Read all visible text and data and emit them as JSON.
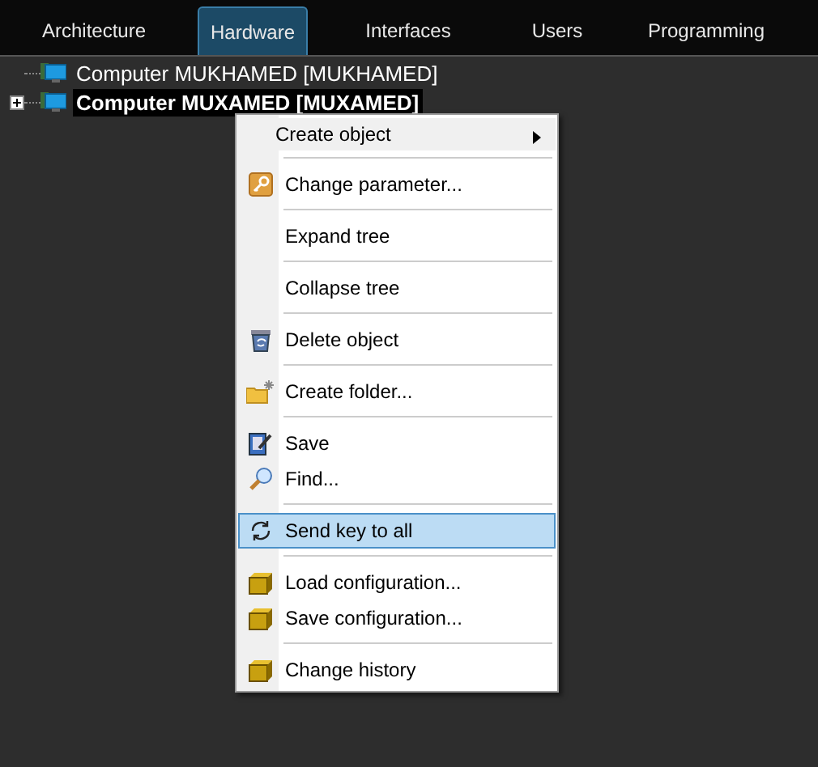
{
  "tabs": [
    {
      "label": "Architecture",
      "selected": false
    },
    {
      "label": "Hardware",
      "selected": true
    },
    {
      "label": "Interfaces",
      "selected": false
    },
    {
      "label": "Users",
      "selected": false
    },
    {
      "label": "Programming",
      "selected": false
    }
  ],
  "tree": [
    {
      "label": "Computer MUKHAMED [MUKHAMED]",
      "selected": false,
      "expandable": false
    },
    {
      "label": "Computer MUXAMED [MUXAMED]",
      "selected": true,
      "expandable": true
    }
  ],
  "context_menu": [
    {
      "kind": "submenu",
      "label": "Create object",
      "selected": false
    },
    {
      "kind": "separator"
    },
    {
      "kind": "key",
      "label": "Change parameter...",
      "selected": false
    },
    {
      "kind": "separator"
    },
    {
      "kind": "plain",
      "label": "Expand tree",
      "selected": false
    },
    {
      "kind": "separator"
    },
    {
      "kind": "plain",
      "label": "Collapse tree",
      "selected": false
    },
    {
      "kind": "separator"
    },
    {
      "kind": "trash",
      "label": "Delete object",
      "selected": false
    },
    {
      "kind": "separator"
    },
    {
      "kind": "folder",
      "label": "Create folder...",
      "selected": false
    },
    {
      "kind": "separator"
    },
    {
      "kind": "save",
      "label": "Save",
      "selected": false
    },
    {
      "kind": "find",
      "label": "Find...",
      "selected": false
    },
    {
      "kind": "separator"
    },
    {
      "kind": "sync",
      "label": "Send key to all",
      "selected": true
    },
    {
      "kind": "separator"
    },
    {
      "kind": "box",
      "label": "Load configuration...",
      "selected": false
    },
    {
      "kind": "box",
      "label": "Save configuration...",
      "selected": false
    },
    {
      "kind": "separator"
    },
    {
      "kind": "box",
      "label": "Change history",
      "selected": false
    }
  ]
}
